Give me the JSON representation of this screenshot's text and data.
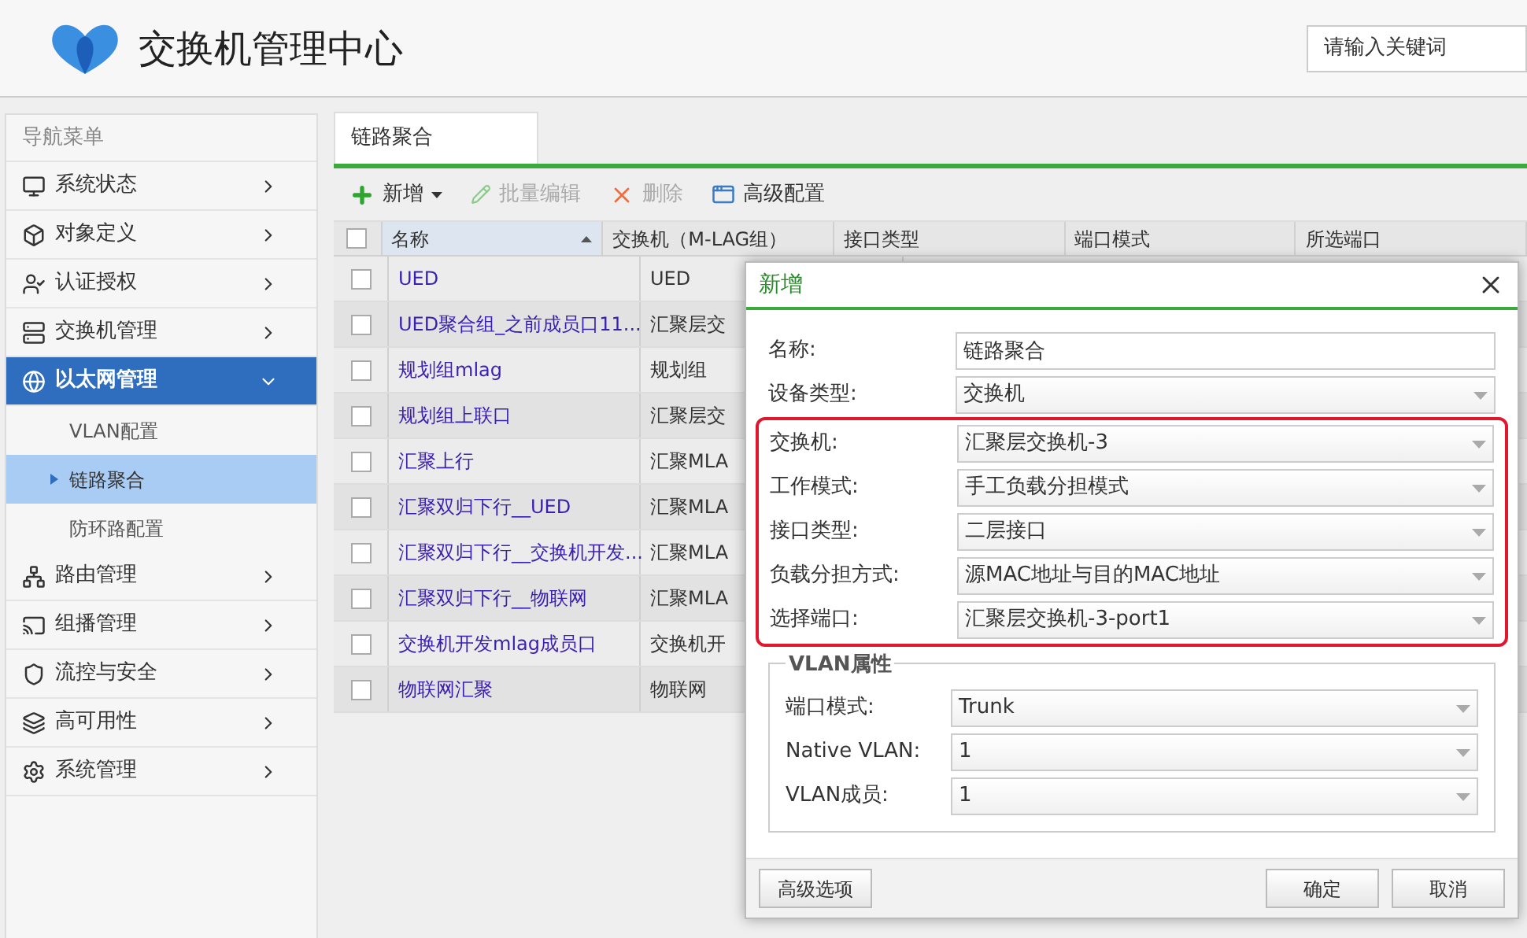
{
  "header": {
    "title": "交换机管理中心",
    "search": {
      "placeholder": "请输入关键词"
    }
  },
  "sidebar": {
    "title": "导航菜单",
    "items": [
      {
        "label": "系统状态",
        "expanded": false
      },
      {
        "label": "对象定义",
        "expanded": false
      },
      {
        "label": "认证授权",
        "expanded": false
      },
      {
        "label": "交换机管理",
        "expanded": false
      },
      {
        "label": "以太网管理",
        "expanded": true,
        "children": [
          {
            "label": "VLAN配置",
            "selected": false
          },
          {
            "label": "链路聚合",
            "selected": true
          },
          {
            "label": "防环路配置",
            "selected": false
          }
        ]
      },
      {
        "label": "路由管理",
        "expanded": false
      },
      {
        "label": "组播管理",
        "expanded": false
      },
      {
        "label": "流控与安全",
        "expanded": false
      },
      {
        "label": "高可用性",
        "expanded": false
      },
      {
        "label": "系统管理",
        "expanded": false
      }
    ]
  },
  "tabs": [
    {
      "label": "链路聚合",
      "selected": true
    }
  ],
  "toolbar": [
    {
      "label": "新增",
      "disabled": false,
      "dropdown": true
    },
    {
      "label": "批量编辑",
      "disabled": true,
      "dropdown": false
    },
    {
      "label": "删除",
      "disabled": true,
      "dropdown": false
    },
    {
      "label": "高级配置",
      "disabled": false,
      "dropdown": false
    }
  ],
  "table": {
    "all_checked": false,
    "columns": [
      "名称",
      "交换机（M-LAG组）",
      "接口类型",
      "端口模式",
      "所选端口"
    ],
    "rows": [
      {
        "checked": false,
        "cells": [
          "UED",
          "UED"
        ]
      },
      {
        "checked": false,
        "cells": [
          "UED聚合组_之前成员口11...",
          "汇聚层交"
        ]
      },
      {
        "checked": false,
        "cells": [
          "规划组mlag",
          "规划组"
        ]
      },
      {
        "checked": false,
        "cells": [
          "规划组上联口",
          "汇聚层交"
        ]
      },
      {
        "checked": false,
        "cells": [
          "汇聚上行",
          "汇聚MLA"
        ]
      },
      {
        "checked": false,
        "cells": [
          "汇聚双归下行__UED",
          "汇聚MLA"
        ]
      },
      {
        "checked": false,
        "cells": [
          "汇聚双归下行__交换机开发...",
          "汇聚MLA"
        ]
      },
      {
        "checked": false,
        "cells": [
          "汇聚双归下行__物联网",
          "汇聚MLA"
        ]
      },
      {
        "checked": false,
        "cells": [
          "交换机开发mlag成员口",
          "交换机开"
        ]
      },
      {
        "checked": false,
        "cells": [
          "物联网汇聚",
          "物联网"
        ]
      }
    ]
  },
  "dialog": {
    "title": "新增",
    "fields": [
      {
        "label": "名称:",
        "kind": "text",
        "value": "链路聚合"
      },
      {
        "label": "设备类型:",
        "kind": "select",
        "value": "交换机"
      }
    ],
    "highlighted_fields": [
      {
        "label": "交换机:",
        "kind": "select",
        "value": "汇聚层交换机-3"
      },
      {
        "label": "工作模式:",
        "kind": "select",
        "value": "手工负载分担模式"
      },
      {
        "label": "接口类型:",
        "kind": "select",
        "value": "二层接口"
      },
      {
        "label": "负载分担方式:",
        "kind": "select",
        "value": "源MAC地址与目的MAC地址"
      },
      {
        "label": "选择端口:",
        "kind": "select",
        "value": "汇聚层交换机-3-port1"
      }
    ],
    "vlan_section": {
      "legend": "VLAN属性",
      "fields": [
        {
          "label": "端口模式:",
          "kind": "select",
          "value": "Trunk"
        },
        {
          "label": "Native VLAN:",
          "kind": "select",
          "value": "1"
        },
        {
          "label": "VLAN成员:",
          "kind": "select",
          "value": "1"
        }
      ]
    },
    "buttons": {
      "left": "高级选项",
      "right": [
        "确定",
        "取消"
      ]
    }
  }
}
